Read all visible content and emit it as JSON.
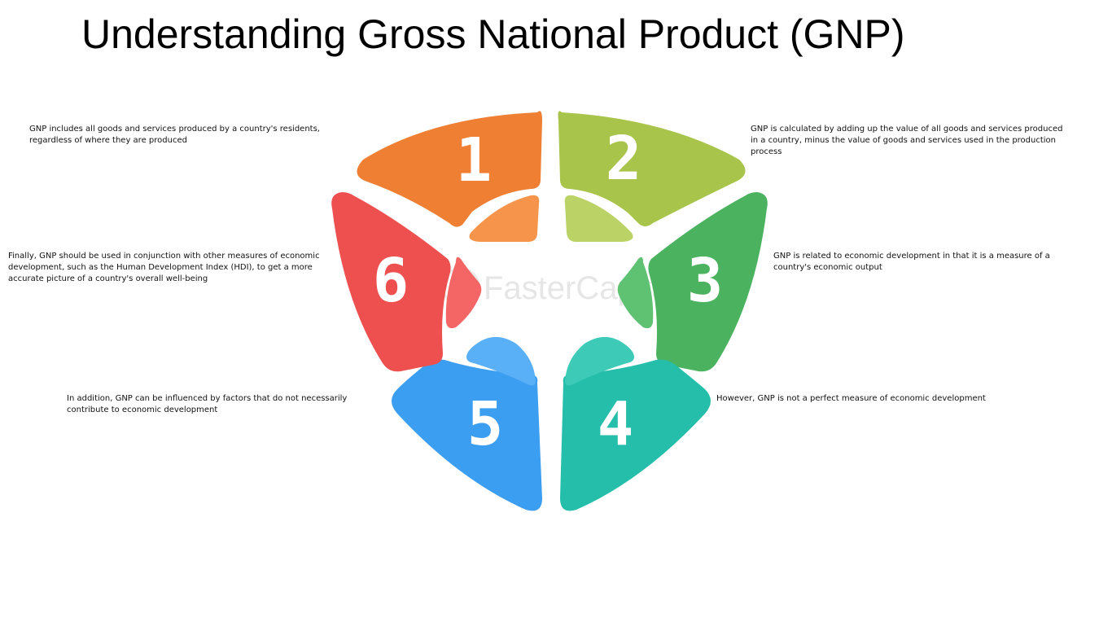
{
  "title": "Understanding Gross National Product (GNP)",
  "watermark": "FasterCapital",
  "segments": [
    {
      "number": "1",
      "color": "#ee7f33",
      "inner_color": "#f5944a",
      "caption": "GNP includes all goods and services produced by a country's residents, regardless of where they are produced"
    },
    {
      "number": "2",
      "color": "#a9c44a",
      "inner_color": "#bad266",
      "caption": "GNP is calculated by adding up the value of all goods and services produced in a country, minus the value of goods and services used in the production process"
    },
    {
      "number": "3",
      "color": "#4bb35f",
      "inner_color": "#5fc273",
      "caption": "GNP is related to economic development in that it is a measure of a country's economic output"
    },
    {
      "number": "4",
      "color": "#25beaa",
      "inner_color": "#3dcbb8",
      "caption": "However, GNP is not a perfect measure of economic development"
    },
    {
      "number": "5",
      "color": "#3c9ef0",
      "inner_color": "#5ab0f6",
      "caption": "In addition, GNP can be influenced by factors that do not necessarily contribute to economic development"
    },
    {
      "number": "6",
      "color": "#ee4f4f",
      "inner_color": "#f46666",
      "caption": "Finally, GNP should be used in conjunction with other measures of economic development, such as the Human Development Index (HDI), to get a more accurate picture of a country's overall well-being"
    }
  ]
}
